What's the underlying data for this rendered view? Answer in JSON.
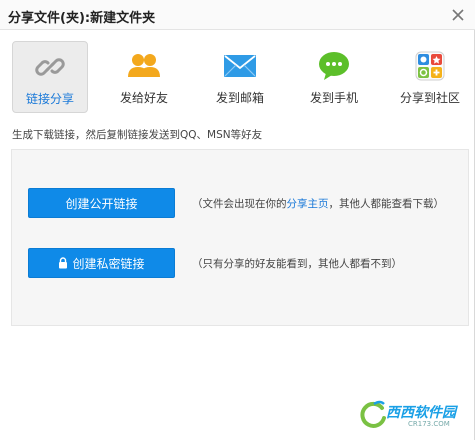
{
  "window": {
    "title": "分享文件(夹):新建文件夹"
  },
  "tabs": [
    {
      "label": "链接分享",
      "icon": "chain-link-icon",
      "active": true
    },
    {
      "label": "发给好友",
      "icon": "friends-icon",
      "active": false
    },
    {
      "label": "发到邮箱",
      "icon": "mail-envelope-icon",
      "active": false
    },
    {
      "label": "发到手机",
      "icon": "chat-bubble-icon",
      "active": false
    },
    {
      "label": "分享到社区",
      "icon": "community-apps-icon",
      "active": false
    }
  ],
  "colors": {
    "accent": "#1878d8",
    "button": "#0f8ae8",
    "mail": "#2f9be6",
    "chat": "#5cbf2a",
    "friends": "#f3a81d"
  },
  "description": "生成下载链接，然后复制链接发送到QQ、MSN等好友",
  "public_link": {
    "button_label": "创建公开链接",
    "note_prefix": "（文件会出现在你的",
    "note_link": "分享主页",
    "note_suffix": "，其他人都能查看下载）"
  },
  "private_link": {
    "button_label": "创建私密链接",
    "note": "（只有分享的好友能看到，其他人都看不到）"
  },
  "watermark": {
    "text": "西西软件园",
    "sub": "CR173.COM"
  }
}
